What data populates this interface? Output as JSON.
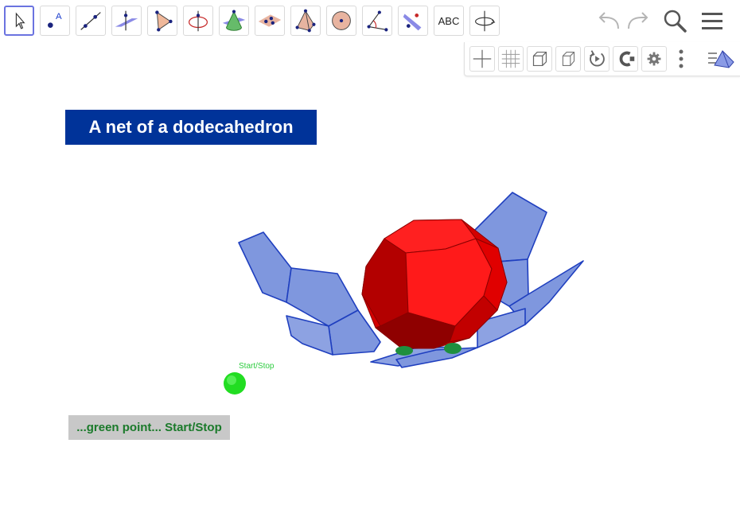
{
  "toolbar": {
    "tools": [
      {
        "name": "move-tool",
        "icon": "cursor-arrow-icon"
      },
      {
        "name": "point-tool",
        "icon": "point-icon",
        "label": "A"
      },
      {
        "name": "line-tool",
        "icon": "line-icon"
      },
      {
        "name": "intersect-plane-tool",
        "icon": "plane-line-icon"
      },
      {
        "name": "polygon-tool",
        "icon": "triangle-icon"
      },
      {
        "name": "circle-axis-tool",
        "icon": "circle-axis-icon"
      },
      {
        "name": "cone-tool",
        "icon": "cone-icon"
      },
      {
        "name": "plane-tool",
        "icon": "plane-points-icon"
      },
      {
        "name": "pyramid-tool",
        "icon": "pyramid-icon"
      },
      {
        "name": "sphere-tool",
        "icon": "sphere-icon"
      },
      {
        "name": "angle-tool",
        "icon": "angle-icon"
      },
      {
        "name": "reflect-tool",
        "icon": "reflect-plane-icon"
      },
      {
        "name": "text-tool",
        "icon": "text-icon",
        "label": "ABC"
      },
      {
        "name": "rotate-view-tool",
        "icon": "rotate-view-icon"
      }
    ],
    "right": [
      "undo-icon",
      "redo-icon",
      "search-icon",
      "menu-icon"
    ]
  },
  "style_bar": [
    "axes-icon",
    "grid-icon",
    "cube-view-icon",
    "projection-icon",
    "rotate-icon",
    "clipping-icon",
    "settings-icon",
    "more-icon",
    "view-menu-icon"
  ],
  "title": "A net of a dodecahedron",
  "hint": "...green point... Start/Stop",
  "point_label": "Start/Stop",
  "colors": {
    "net_face": "#7f97de",
    "net_edge": "#1f3fbf",
    "solid": "#ff1a1a",
    "point": "#22dd22",
    "title_bg": "#003399"
  }
}
